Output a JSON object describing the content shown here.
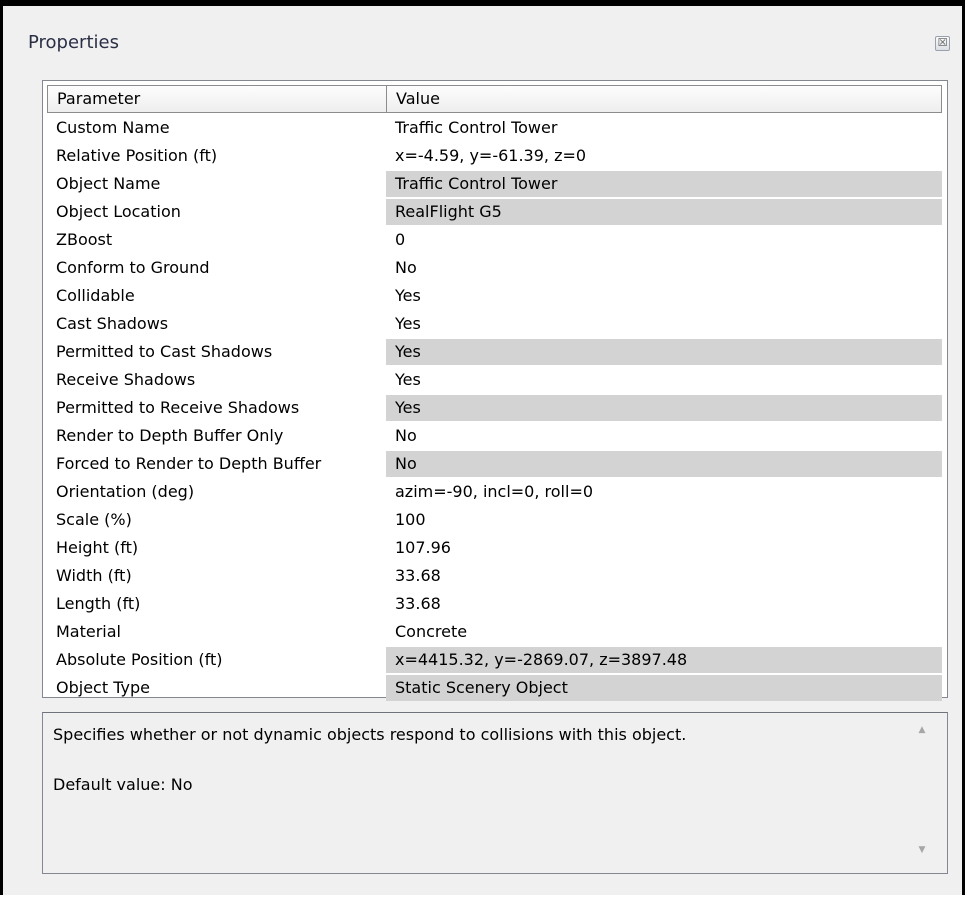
{
  "window": {
    "title": "Properties",
    "close_glyph": "☒"
  },
  "grid": {
    "headers": {
      "parameter": "Parameter",
      "value": "Value"
    },
    "rows": [
      {
        "parameter": "Custom Name",
        "value": "Traffic Control Tower",
        "read_only": false
      },
      {
        "parameter": "Relative Position (ft)",
        "value": "x=-4.59, y=-61.39, z=0",
        "read_only": false
      },
      {
        "parameter": "Object Name",
        "value": "Traffic Control Tower",
        "read_only": true
      },
      {
        "parameter": "Object Location",
        "value": "RealFlight G5",
        "read_only": true
      },
      {
        "parameter": "ZBoost",
        "value": "0",
        "read_only": false
      },
      {
        "parameter": "Conform to Ground",
        "value": "No",
        "read_only": false
      },
      {
        "parameter": "Collidable",
        "value": "Yes",
        "read_only": false
      },
      {
        "parameter": "Cast Shadows",
        "value": "Yes",
        "read_only": false
      },
      {
        "parameter": "Permitted to Cast Shadows",
        "value": "Yes",
        "read_only": true
      },
      {
        "parameter": "Receive Shadows",
        "value": "Yes",
        "read_only": false
      },
      {
        "parameter": "Permitted to Receive Shadows",
        "value": "Yes",
        "read_only": true
      },
      {
        "parameter": "Render to Depth Buffer Only",
        "value": "No",
        "read_only": false
      },
      {
        "parameter": "Forced to Render to Depth Buffer",
        "value": "No",
        "read_only": true
      },
      {
        "parameter": "Orientation (deg)",
        "value": "azim=-90, incl=0, roll=0",
        "read_only": false
      },
      {
        "parameter": "Scale (%)",
        "value": "100",
        "read_only": false
      },
      {
        "parameter": "Height (ft)",
        "value": "107.96",
        "read_only": false
      },
      {
        "parameter": "Width (ft)",
        "value": "33.68",
        "read_only": false
      },
      {
        "parameter": "Length (ft)",
        "value": "33.68",
        "read_only": false
      },
      {
        "parameter": "Material",
        "value": "Concrete",
        "read_only": false
      },
      {
        "parameter": "Absolute Position (ft)",
        "value": "x=4415.32, y=-2869.07, z=3897.48",
        "read_only": true
      },
      {
        "parameter": "Object Type",
        "value": "Static Scenery Object",
        "read_only": true
      }
    ]
  },
  "description": {
    "text": "Specifies whether or not dynamic objects respond to collisions with this object.",
    "default": "Default value: No",
    "scroll_up_glyph": "▲",
    "scroll_down_glyph": "▼"
  },
  "colors": {
    "read_only_background": "#d3d3d3",
    "panel_background": "#f0f0f0",
    "title_text": "#2a2f45"
  }
}
